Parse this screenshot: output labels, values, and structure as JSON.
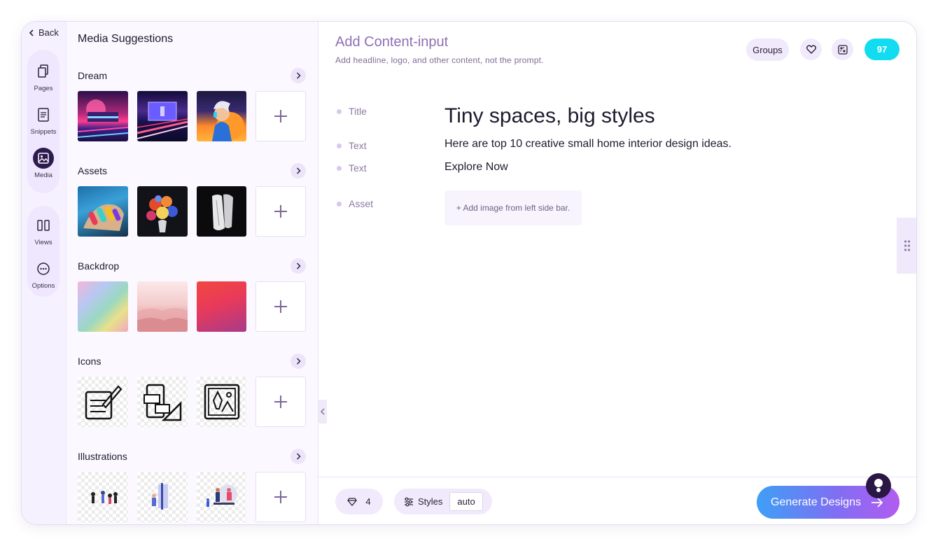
{
  "rail": {
    "back_label": "Back",
    "items": [
      {
        "label": "Pages",
        "icon": "pages-icon"
      },
      {
        "label": "Snippets",
        "icon": "snippets-icon"
      },
      {
        "label": "Media",
        "icon": "media-icon",
        "active": true
      },
      {
        "label": "Views",
        "icon": "views-icon"
      },
      {
        "label": "Options",
        "icon": "options-icon"
      }
    ]
  },
  "panel": {
    "title": "Media Suggestions",
    "sections": [
      {
        "title": "Dream"
      },
      {
        "title": "Assets"
      },
      {
        "title": "Backdrop"
      },
      {
        "title": "Icons"
      },
      {
        "title": "Illustrations"
      }
    ]
  },
  "main": {
    "title": "Add Content-input",
    "subtitle": "Add headline, logo, and other content, not the prompt.",
    "groups_label": "Groups",
    "credits": "97",
    "fields": [
      {
        "label": "Title",
        "value": "Tiny spaces, big styles"
      },
      {
        "label": "Text",
        "value": "Here are top 10 creative small home interior design ideas."
      },
      {
        "label": "Text",
        "value": "Explore Now"
      },
      {
        "label": "Asset",
        "value": "+ Add image from left side bar."
      }
    ]
  },
  "bottom": {
    "gems": "4",
    "styles_label": "Styles",
    "styles_value": "auto",
    "generate_label": "Generate Designs"
  },
  "colors": {
    "accent": "#8e6fb4",
    "credits_bg": "#12dcf0",
    "generate_from": "#3e9ff6",
    "generate_to": "#b15cf0"
  }
}
